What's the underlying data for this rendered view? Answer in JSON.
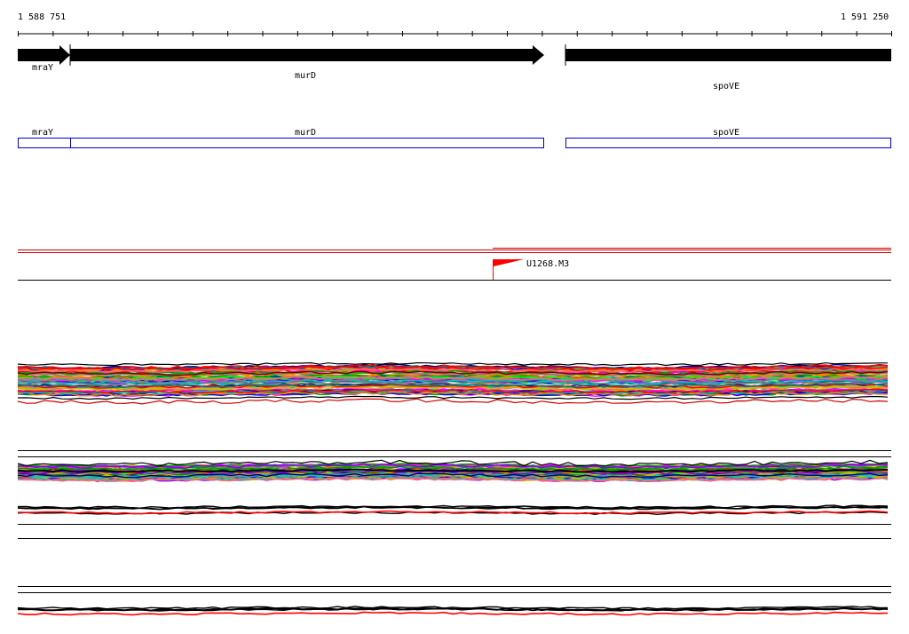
{
  "ruler": {
    "start": "1 588 751",
    "end": "1 591 250"
  },
  "genes": [
    {
      "name": "mraY",
      "strand": "+"
    },
    {
      "name": "murD",
      "strand": "+"
    },
    {
      "name": "spoVE",
      "strand": "+"
    }
  ],
  "features": {
    "marker": "U1268.M3"
  },
  "colors": {
    "gene_arrow": "#000000",
    "gene_box": "#0000cc",
    "marker": "#ff0000",
    "track_line": "#000000",
    "highlight_line": "#ff0000"
  },
  "trace_palette": [
    "#ff0000",
    "#00a000",
    "#0000ff",
    "#ff00ff",
    "#00c0c0",
    "#c0c000",
    "#ff8000",
    "#8000ff",
    "#008080",
    "#800000",
    "#00ff00",
    "#808080",
    "#000080",
    "#ff6080"
  ]
}
